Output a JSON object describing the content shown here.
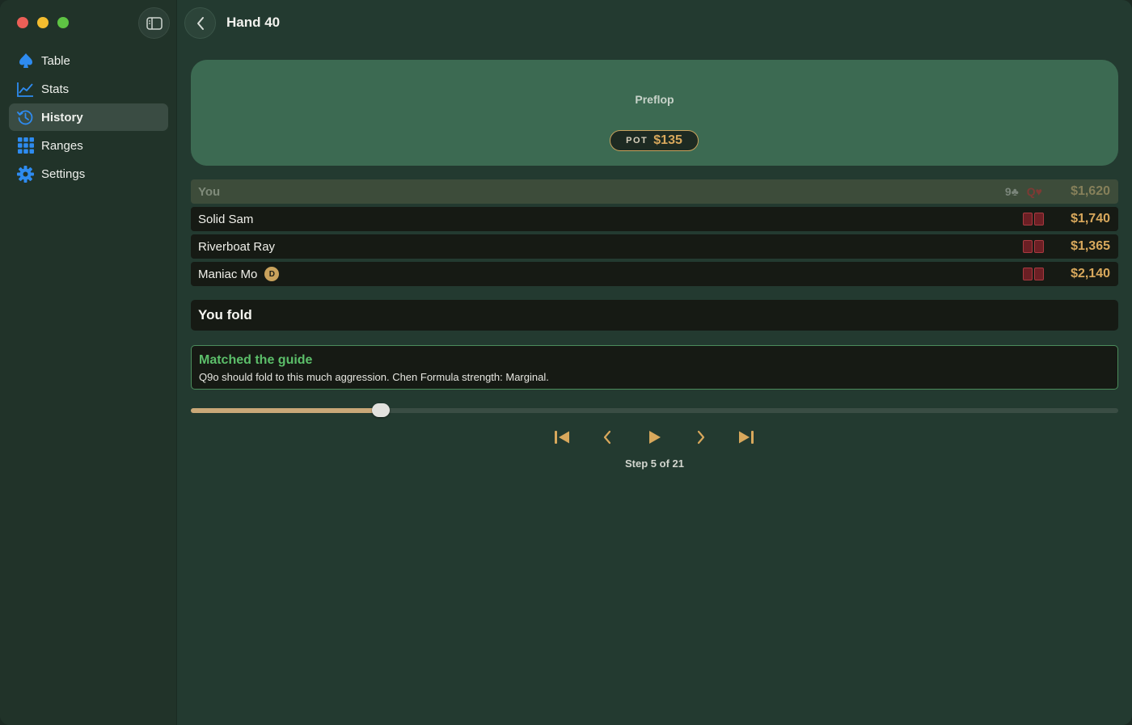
{
  "window": {
    "title": "Hand 40"
  },
  "sidebar": {
    "items": [
      {
        "label": "Table",
        "icon": "spade-icon",
        "active": false
      },
      {
        "label": "Stats",
        "icon": "chart-line-icon",
        "active": false
      },
      {
        "label": "History",
        "icon": "history-clock-icon",
        "active": true
      },
      {
        "label": "Ranges",
        "icon": "grid-icon",
        "active": false
      },
      {
        "label": "Settings",
        "icon": "gear-icon",
        "active": false
      }
    ]
  },
  "felt": {
    "street": "Preflop",
    "pot_label": "POT",
    "pot_amount": "$135"
  },
  "players": [
    {
      "name": "You",
      "hole_cards": [
        "9♣",
        "Q♥"
      ],
      "stack": "$1,620",
      "dealer": false
    },
    {
      "name": "Solid Sam",
      "stack": "$1,740",
      "dealer": false
    },
    {
      "name": "Riverboat Ray",
      "stack": "$1,365",
      "dealer": false
    },
    {
      "name": "Maniac Mo",
      "stack": "$2,140",
      "dealer": true,
      "dealer_label": "D"
    }
  ],
  "action": {
    "text": "You fold"
  },
  "guide": {
    "title": "Matched the guide",
    "body": "Q9o should fold to this much aggression. Chen Formula strength: Marginal."
  },
  "playback": {
    "current_step": 5,
    "total_steps": 21,
    "step_label": "Step 5 of 21",
    "progress": 0.205
  },
  "colors": {
    "accent_gold": "#d8a85c",
    "felt_green": "#3c6a52",
    "guide_green": "#5cbf6a",
    "nav_icon_blue": "#2e8bf0"
  }
}
